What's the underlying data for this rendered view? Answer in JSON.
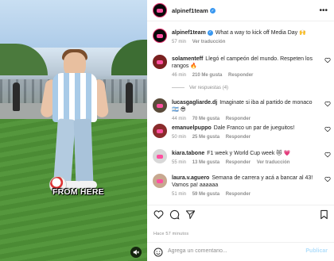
{
  "video": {
    "caption": "FROM HERE",
    "mute_icon": "speaker-muted-icon"
  },
  "post": {
    "author": "alpinef1team",
    "more_icon": "more-options-icon"
  },
  "caption_comment": {
    "user": "alpinef1team",
    "text": "What a way to kick off Media Day 🙌",
    "time": "57 min",
    "translate": "Ver traducción"
  },
  "comments": [
    {
      "user": "solamenteff",
      "text": "Llegó el campeón del mundo. Respeten los rangos 🔥",
      "time": "46 min",
      "likes": "210 Me gusta",
      "reply": "Responder",
      "replies": "Ver respuestas (4)",
      "avatar_color": "#7a2020"
    },
    {
      "user": "lucasgagliarde.dj",
      "text": "Imaginate si iba al partido de monaco 🇦🇷 😎",
      "time": "44 min",
      "likes": "70 Me gusta",
      "reply": "Responder",
      "avatar_color": "#5a4b3a"
    },
    {
      "user": "emanuelpuppo",
      "text": "Dale Franco un par de jueguitos!",
      "time": "50 min",
      "likes": "25 Me gusta",
      "reply": "Responder",
      "avatar_color": "#8a2c2c"
    },
    {
      "user": "kiara.tabone",
      "text": "F1 week y World Cup week 😻 💗",
      "time": "55 min",
      "likes": "13 Me gusta",
      "reply": "Responder",
      "translate": "Ver traducción",
      "avatar_color": "#d8d8d8"
    },
    {
      "user": "laura.v.aguero",
      "text": "Semana de carrera y acá a bancar al 43! Vamos pa! aaaaaa",
      "time": "51 min",
      "likes": "59 Me gusta",
      "reply": "Responder",
      "avatar_color": "#c8a890"
    }
  ],
  "footer": {
    "posted_ago": "Hace 57 minutos",
    "comment_placeholder": "Agrega un comentario...",
    "publish_label": "Publicar"
  },
  "colors": {
    "verified": "#3897f0",
    "muted_text": "#8e8e8e",
    "publish": "#b2dffc"
  }
}
